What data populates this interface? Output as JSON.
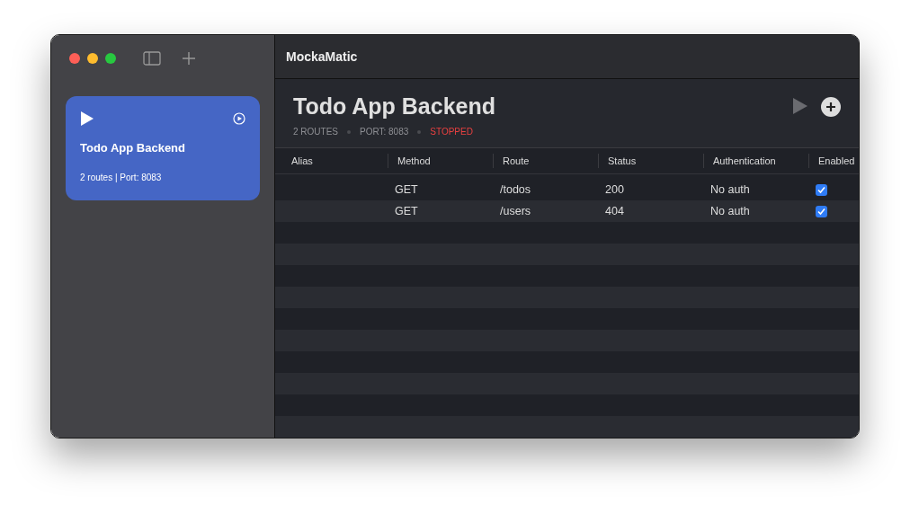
{
  "window": {
    "title": "MockaMatic"
  },
  "sidebar": {
    "servers": [
      {
        "name": "Todo App Backend",
        "info": "2 routes | Port: 8083",
        "selected": true
      }
    ]
  },
  "server": {
    "title": "Todo App Backend",
    "routes": "2 ROUTES",
    "port": "PORT: 8083",
    "status": "STOPPED",
    "running": false
  },
  "table": {
    "columns": [
      "Alias",
      "Method",
      "Route",
      "Status",
      "Authentication",
      "Enabled"
    ],
    "rows": [
      {
        "alias": "",
        "method": "GET",
        "route": "/todos",
        "status": "200",
        "auth": "No auth",
        "enabled": true
      },
      {
        "alias": "",
        "method": "GET",
        "route": "/users",
        "status": "404",
        "auth": "No auth",
        "enabled": true
      }
    ]
  }
}
